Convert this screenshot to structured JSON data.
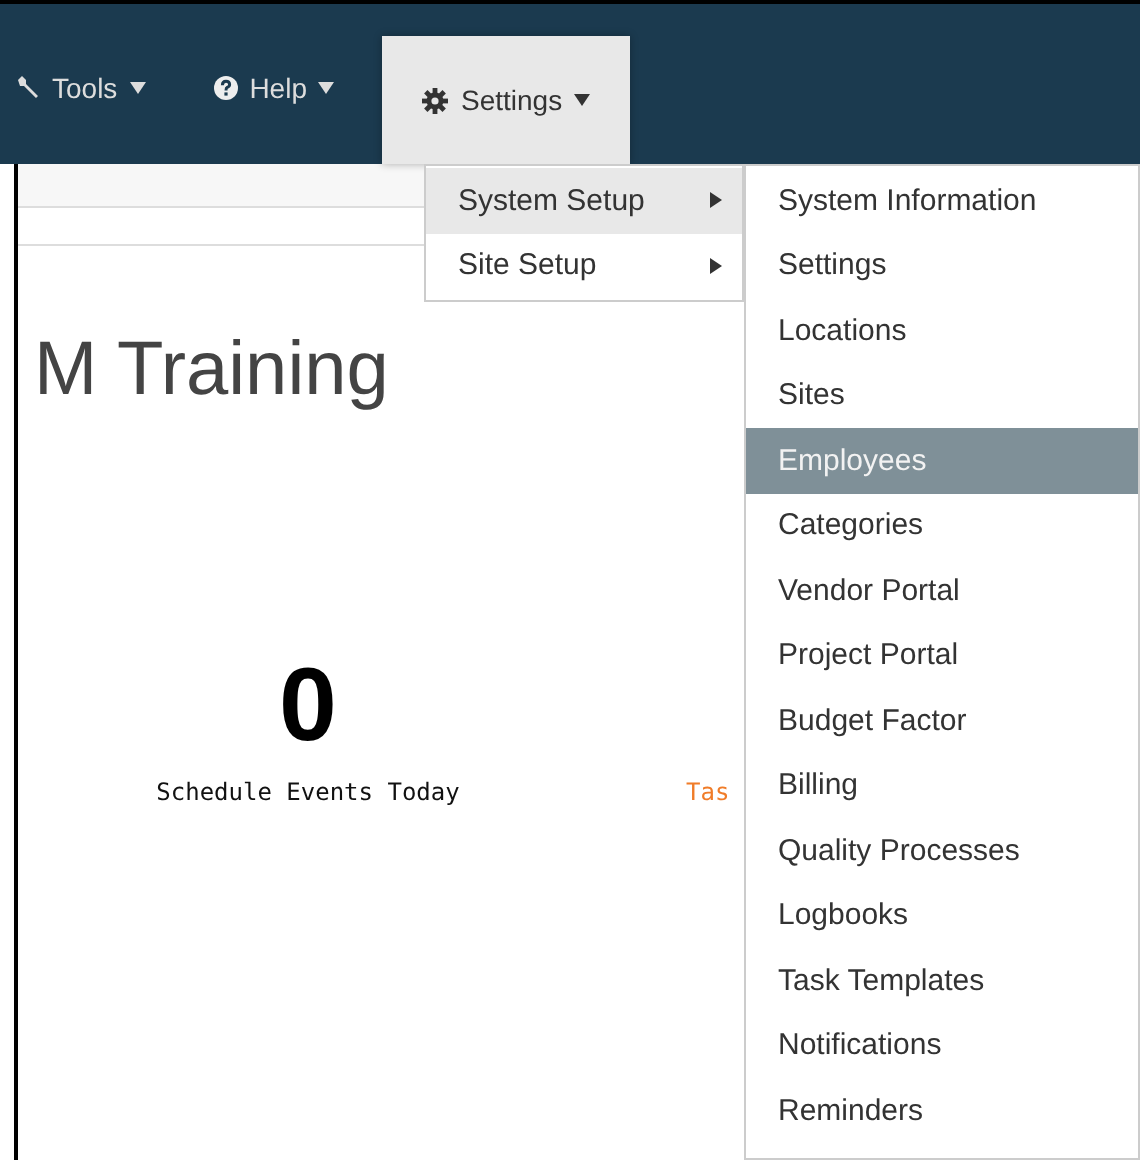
{
  "navbar": {
    "items": [
      {
        "label": "Tools",
        "open": false
      },
      {
        "label": "Help",
        "open": false
      },
      {
        "label": "Settings",
        "open": true
      }
    ]
  },
  "settings_menu": {
    "items": [
      {
        "label": "System Setup",
        "selected": true
      },
      {
        "label": "Site Setup",
        "selected": false
      }
    ]
  },
  "system_setup_menu": {
    "items": [
      {
        "label": "System Information",
        "selected": false
      },
      {
        "label": "Settings",
        "selected": false
      },
      {
        "label": "Locations",
        "selected": false
      },
      {
        "label": "Sites",
        "selected": false
      },
      {
        "label": "Employees",
        "selected": true
      },
      {
        "label": "Categories",
        "selected": false
      },
      {
        "label": "Vendor Portal",
        "selected": false
      },
      {
        "label": "Project Portal",
        "selected": false
      },
      {
        "label": "Budget Factor",
        "selected": false
      },
      {
        "label": "Billing",
        "selected": false
      },
      {
        "label": "Quality Processes",
        "selected": false
      },
      {
        "label": "Logbooks",
        "selected": false
      },
      {
        "label": "Task Templates",
        "selected": false
      },
      {
        "label": "Notifications",
        "selected": false
      },
      {
        "label": "Reminders",
        "selected": false
      }
    ]
  },
  "page": {
    "heading": "M Training",
    "stats": [
      {
        "value": "0",
        "label": "Schedule Events Today"
      }
    ],
    "link_partial": "Tas"
  }
}
